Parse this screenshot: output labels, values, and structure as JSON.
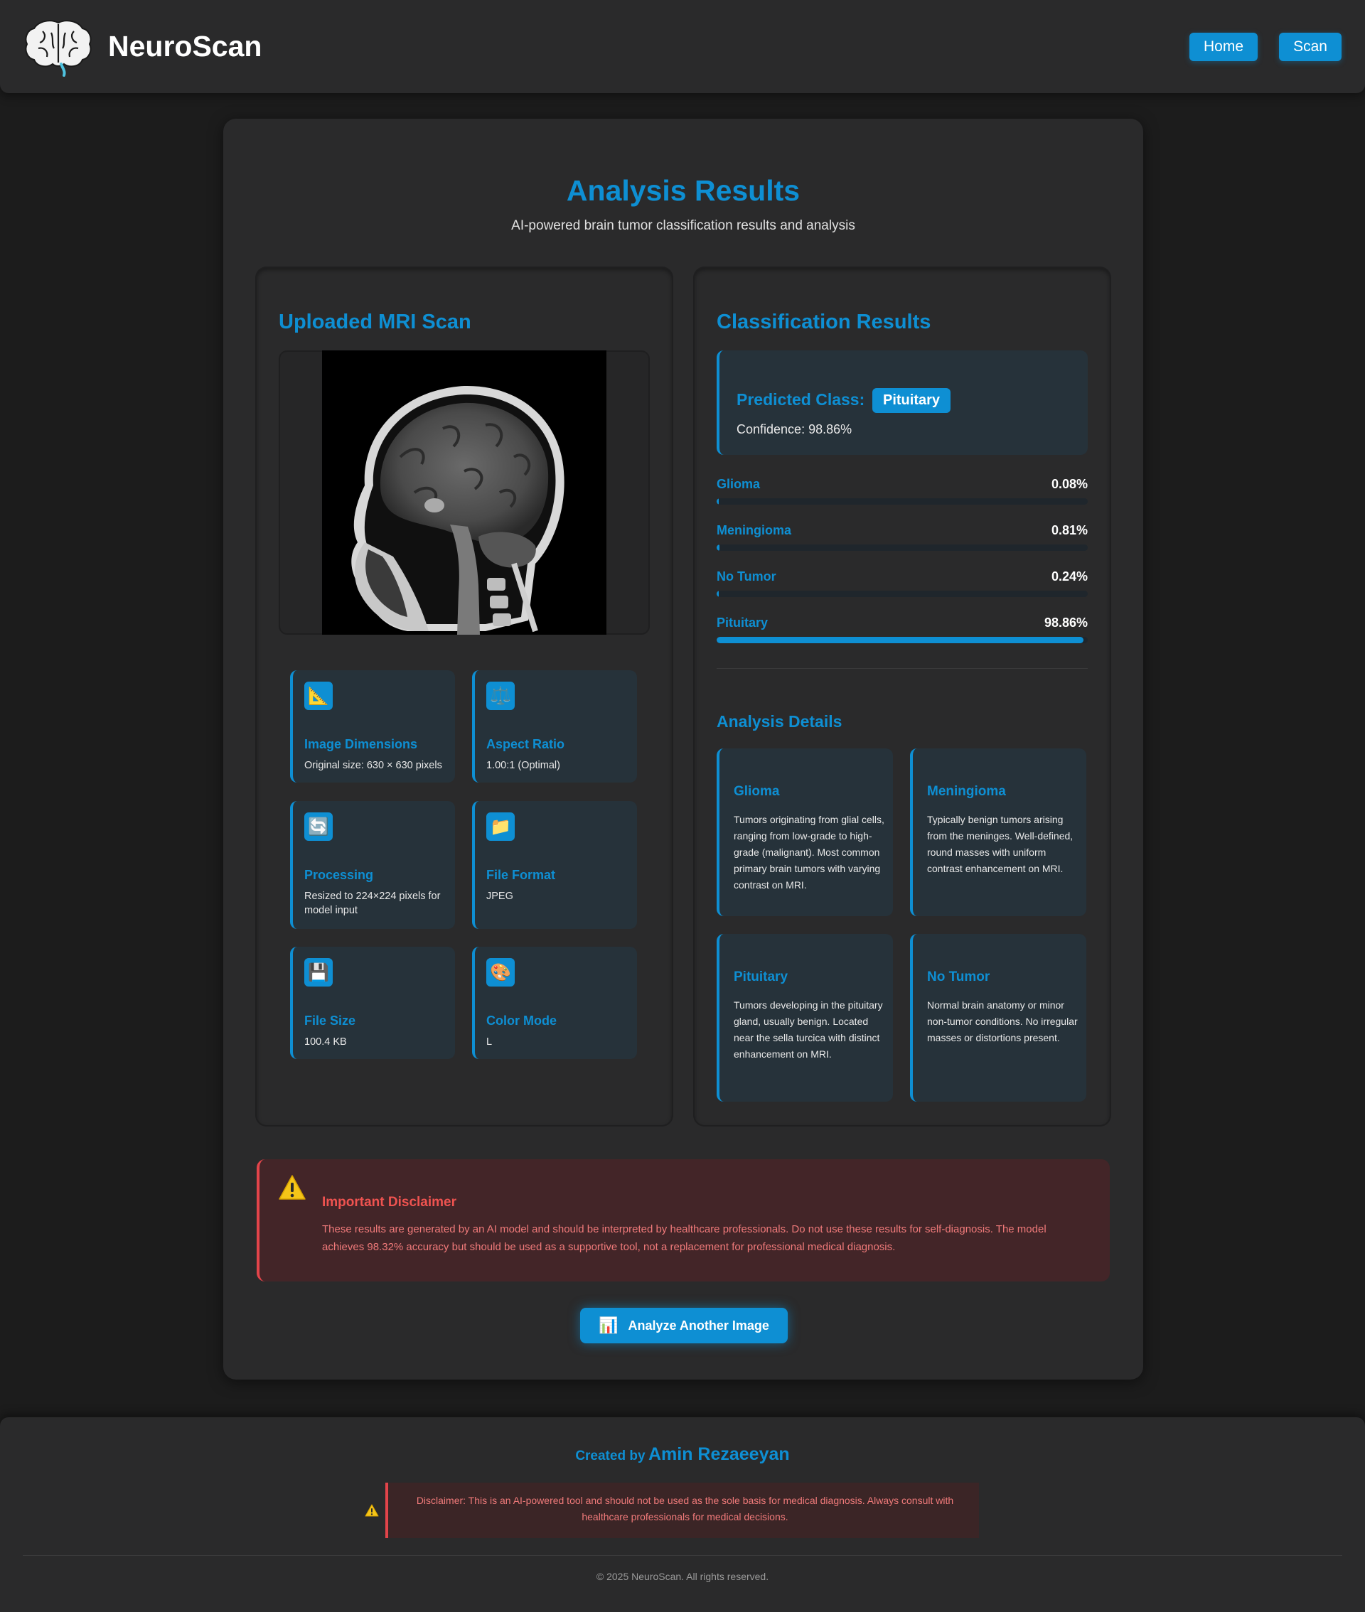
{
  "header": {
    "brand": "NeuroScan",
    "nav": {
      "home_label": "Home",
      "scan_label": "Scan"
    }
  },
  "main": {
    "title": "Analysis Results",
    "subtitle": "AI-powered brain tumor classification results and analysis"
  },
  "upload": {
    "title": "Uploaded MRI Scan",
    "info_cards": [
      {
        "icon": "triangle-ruler-icon",
        "glyph": "📐",
        "title": "Image Dimensions",
        "text": "Original size: 630 × 630 pixels"
      },
      {
        "icon": "scales-icon",
        "glyph": "⚖️",
        "title": "Aspect Ratio",
        "text": "1.00:1 (Optimal)"
      },
      {
        "icon": "refresh-icon",
        "glyph": "🔄",
        "title": "Processing",
        "text": "Resized to 224×224 pixels for model input"
      },
      {
        "icon": "folder-icon",
        "glyph": "📁",
        "title": "File Format",
        "text": "JPEG"
      },
      {
        "icon": "floppy-disk-icon",
        "glyph": "💾",
        "title": "File Size",
        "text": "100.4 KB"
      },
      {
        "icon": "palette-icon",
        "glyph": "🎨",
        "title": "Color Mode",
        "text": "L"
      }
    ]
  },
  "classification": {
    "title": "Classification Results",
    "predicted_label": "Predicted Class:",
    "predicted_class": "Pituitary",
    "confidence": "Confidence: 98.86%",
    "probabilities": [
      {
        "name": "Glioma",
        "value_text": "0.08%",
        "value": 0.08
      },
      {
        "name": "Meningioma",
        "value_text": "0.81%",
        "value": 0.81
      },
      {
        "name": "No Tumor",
        "value_text": "0.24%",
        "value": 0.24
      },
      {
        "name": "Pituitary",
        "value_text": "98.86%",
        "value": 98.86
      }
    ],
    "details_title": "Analysis Details",
    "details": [
      {
        "title": "Glioma",
        "text": "Tumors originating from glial cells, ranging from low-grade to high-grade (malignant). Most common primary brain tumors with varying contrast on MRI."
      },
      {
        "title": "Meningioma",
        "text": "Typically benign tumors arising from the meninges. Well-defined, round masses with uniform contrast enhancement on MRI."
      },
      {
        "title": "Pituitary",
        "text": "Tumors developing in the pituitary gland, usually benign. Located near the sella turcica with distinct enhancement on MRI."
      },
      {
        "title": "No Tumor",
        "text": "Normal brain anatomy or minor non-tumor conditions. No irregular masses or distortions present."
      }
    ]
  },
  "disclaimer": {
    "title": "Important Disclaimer",
    "text": "These results are generated by an AI model and should be interpreted by healthcare professionals. Do not use these results for self-diagnosis. The model achieves 98.32% accuracy but should be used as a supportive tool, not a replacement for professional medical diagnosis."
  },
  "analyze_button": {
    "label": "Analyze Another Image",
    "icon": "bar-chart-icon"
  },
  "footer": {
    "created_by": "Created by",
    "author": "Amin Rezaeeyan",
    "disclaimer": "Disclaimer: This is an AI-powered tool and should not be used as the sole basis for medical diagnosis. Always consult with healthcare professionals for medical decisions.",
    "copyright": "© 2025 NeuroScan. All rights reserved."
  },
  "colors": {
    "accent": "#0e8fd3",
    "background": "#1c1c1c",
    "card": "#2a2a2b",
    "info_card": "#26323a",
    "danger": "#e2444a",
    "danger_bg": "#432528"
  }
}
